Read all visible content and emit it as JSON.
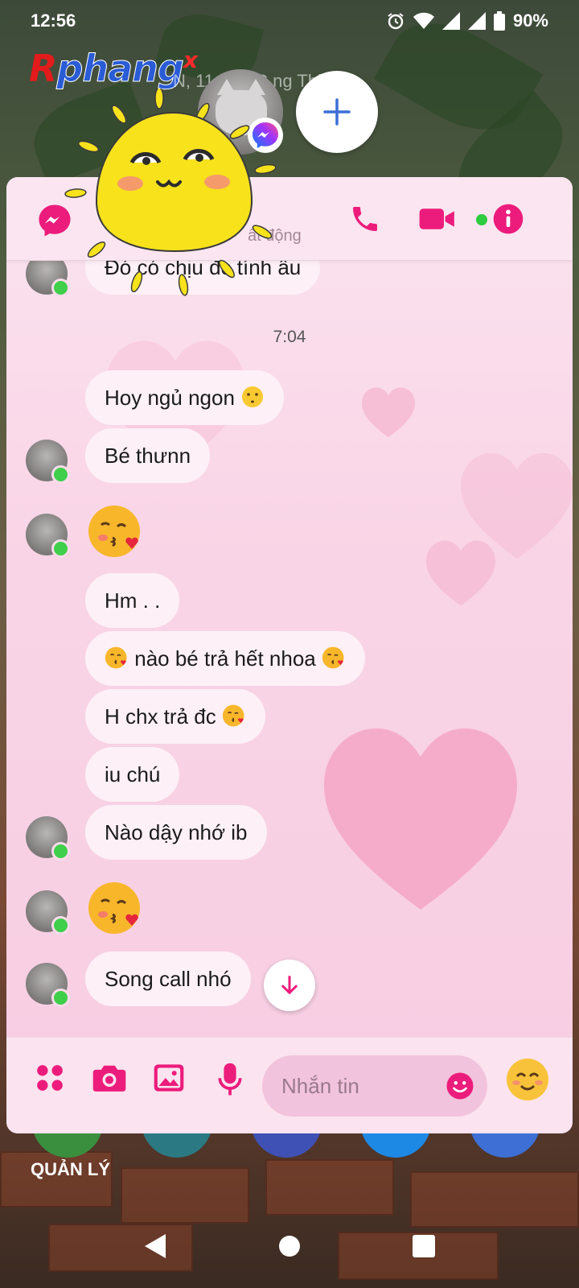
{
  "status_bar": {
    "time": "12:56",
    "battery": "90%"
  },
  "logo": {
    "r": "R",
    "rest": "phang",
    "x": "x"
  },
  "background_widget_text": "N, 11    | 25°C   ng Thịt",
  "chat_header": {
    "active_status": "ất động"
  },
  "messages": {
    "top_partial": "Đó có chịu đc tính âu",
    "timestamp": "7:04",
    "m1": "Hoy ngủ ngon",
    "m2": "Bé thưnn",
    "m3": "Hm . .",
    "m4_text": "nào bé trả hết nhoa",
    "m5_text": "H chx trả đc",
    "m6": "iu chú",
    "m7": "Nào dậy nhớ ib",
    "m8": "Song call nhó"
  },
  "composer": {
    "placeholder": "Nhắn tin"
  },
  "home": {
    "manage_label": "QUẢN LÝ"
  },
  "colors": {
    "accent": "#ec1c7c",
    "bubble": "#fdf0f6",
    "card_bg": "#f9d4e6"
  },
  "icons": [
    "messenger-icon",
    "phone-icon",
    "video-icon",
    "info-icon",
    "apps-icon",
    "camera-icon",
    "gallery-icon",
    "mic-icon",
    "emoji-icon",
    "arrow-down-icon"
  ]
}
